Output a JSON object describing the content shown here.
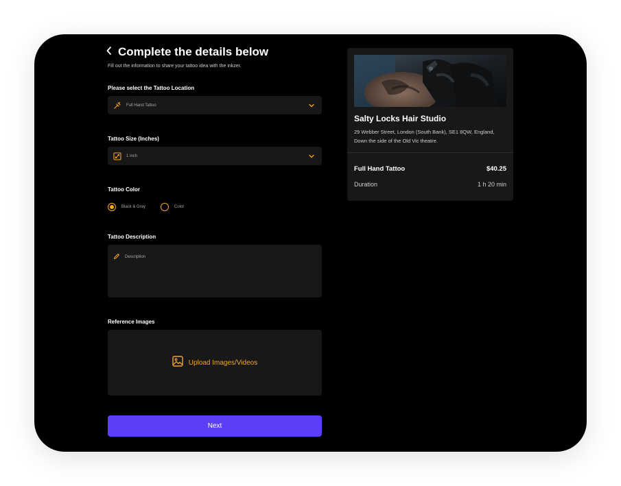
{
  "header": {
    "back_icon": "chevron-left-icon",
    "title": "Complete the details below",
    "subtitle": "Fill out the information to share your tattoo idea with the inkzer."
  },
  "location": {
    "label": "Please select the Tattoo Location",
    "value": "Full Hand Tattoo",
    "icon": "tattoo-machine-icon"
  },
  "size": {
    "label": "Tattoo Size (Inches)",
    "value": "1 inch",
    "icon": "resize-icon"
  },
  "color": {
    "label": "Tattoo Color",
    "options": [
      {
        "label": "Black & Gray",
        "selected": true
      },
      {
        "label": "Color",
        "selected": false
      }
    ]
  },
  "description": {
    "label": "Tattoo Description",
    "placeholder": "Description",
    "icon": "pencil-icon"
  },
  "reference": {
    "label": "Reference Images",
    "upload_label": "Upload Images/Videos",
    "icon": "image-icon"
  },
  "next_button": "Next",
  "studio_card": {
    "name": "Salty Locks Hair Studio",
    "address": "29 Webber Street, London (South Bank), SE1 8QW, England, Down the side of the Old Vic theatre.",
    "service": "Full Hand Tattoo",
    "price": "$40.25",
    "duration_label": "Duration",
    "duration_value": "1 h 20 min"
  },
  "colors": {
    "accent": "#f5a623",
    "primary": "#5b3ef5",
    "surface": "#181818",
    "background": "#000000"
  }
}
